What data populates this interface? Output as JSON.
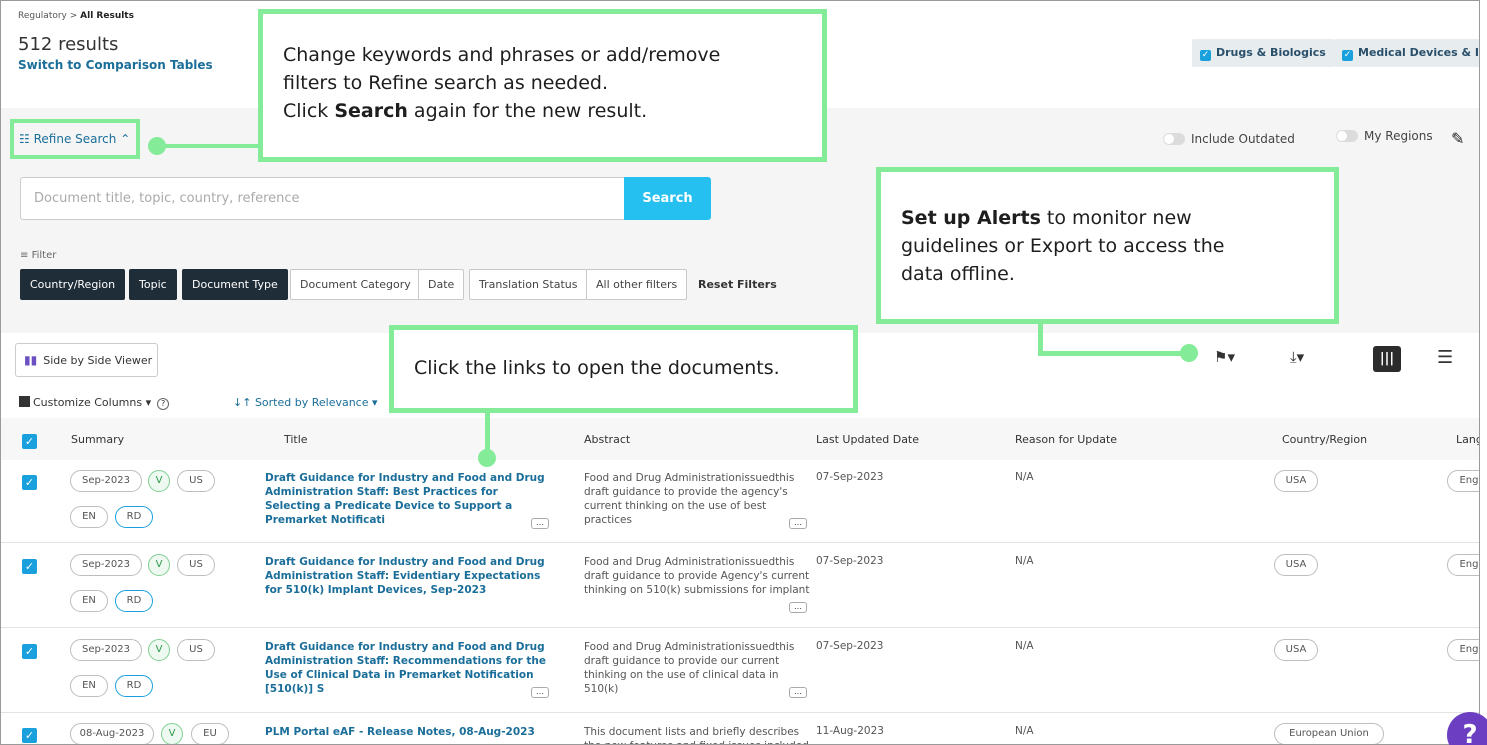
{
  "breadcrumb": {
    "parent": "Regulatory",
    "sep": " > ",
    "current": "All Results"
  },
  "results": {
    "count": "512 results",
    "switch_link": "Switch to Comparison Tables"
  },
  "categories": [
    {
      "label": "Drugs & Biologics",
      "checked": true
    },
    {
      "label": "Medical Devices & IVDs",
      "checked": true
    }
  ],
  "refine": {
    "label": "Refine Search",
    "include_outdated": "Include Outdated",
    "my_regions": "My Regions"
  },
  "search": {
    "placeholder": "Document title, topic, country, reference",
    "button": "Search"
  },
  "filters": {
    "label": "Filter",
    "chips": [
      "Country/Region",
      "Topic",
      "Document Type",
      "Document Category",
      "Date",
      "Translation Status",
      "All other filters"
    ],
    "reset": "Reset Filters"
  },
  "toolbar": {
    "side_by_side": "Side by Side Viewer",
    "customize_columns": "Customize Columns",
    "sorted_by": "Sorted by Relevance"
  },
  "table": {
    "headers": [
      "Summary",
      "Title",
      "Abstract",
      "Last Updated Date",
      "Reason for Update",
      "Country/Region",
      "Lang"
    ],
    "rows": [
      {
        "date_tag": "Sep-2023",
        "v": "V",
        "region_tag": "US",
        "lang_tag": "EN",
        "rd": "RD",
        "title": "Draft Guidance for Industry and Food and Drug Administration Staff: Best Practices for Selecting a Predicate Device to Support a Premarket Notificati",
        "abstract": "Food and Drug Administrationissuedthis draft guidance to provide the agency's current thinking on the use of best practices",
        "updated": "07-Sep-2023",
        "reason": "N/A",
        "country": "USA",
        "lang": "Eng"
      },
      {
        "date_tag": "Sep-2023",
        "v": "V",
        "region_tag": "US",
        "lang_tag": "EN",
        "rd": "RD",
        "title": "Draft Guidance for Industry and Food and Drug Administration Staff: Evidentiary Expectations for 510(k) Implant Devices, Sep-2023",
        "abstract": "Food and Drug Administrationissuedthis draft guidance to provide Agency's current thinking on 510(k) submissions for implant",
        "updated": "07-Sep-2023",
        "reason": "N/A",
        "country": "USA",
        "lang": "Eng"
      },
      {
        "date_tag": "Sep-2023",
        "v": "V",
        "region_tag": "US",
        "lang_tag": "EN",
        "rd": "RD",
        "title": "Draft Guidance for Industry and Food and Drug Administration Staff: Recommendations for the Use of Clinical Data in Premarket Notification [510(k)] S",
        "abstract": "Food and Drug Administrationissuedthis draft guidance to provide our current thinking on the use of clinical data in 510(k)",
        "updated": "07-Sep-2023",
        "reason": "N/A",
        "country": "USA",
        "lang": "Eng"
      },
      {
        "date_tag": "08-Aug-2023",
        "v": "V",
        "region_tag": "EU",
        "title": "PLM Portal eAF - Release Notes, 08-Aug-2023",
        "abstract": "This document lists and briefly describes the new features and fixed issues included",
        "updated": "11-Aug-2023",
        "reason": "N/A",
        "country": "European Union"
      }
    ]
  },
  "callouts": {
    "refine": {
      "line1": "Change keywords and phrases or add/remove",
      "line2": "filters to Refine search as needed.",
      "line3_pre": "Click ",
      "line3_bold": "Search",
      "line3_post": " again for the new result."
    },
    "alerts": {
      "bold": "Set up Alerts",
      "line1_post": " to monitor new",
      "line2": "guidelines or Export to access the",
      "line3": "data offline."
    },
    "links": {
      "text": "Click the links to open the documents."
    }
  },
  "colors": {
    "accent": "#1aa1dd",
    "callout_green": "#84ec99",
    "link": "#1a6e99",
    "search_button": "#26c0f0"
  }
}
